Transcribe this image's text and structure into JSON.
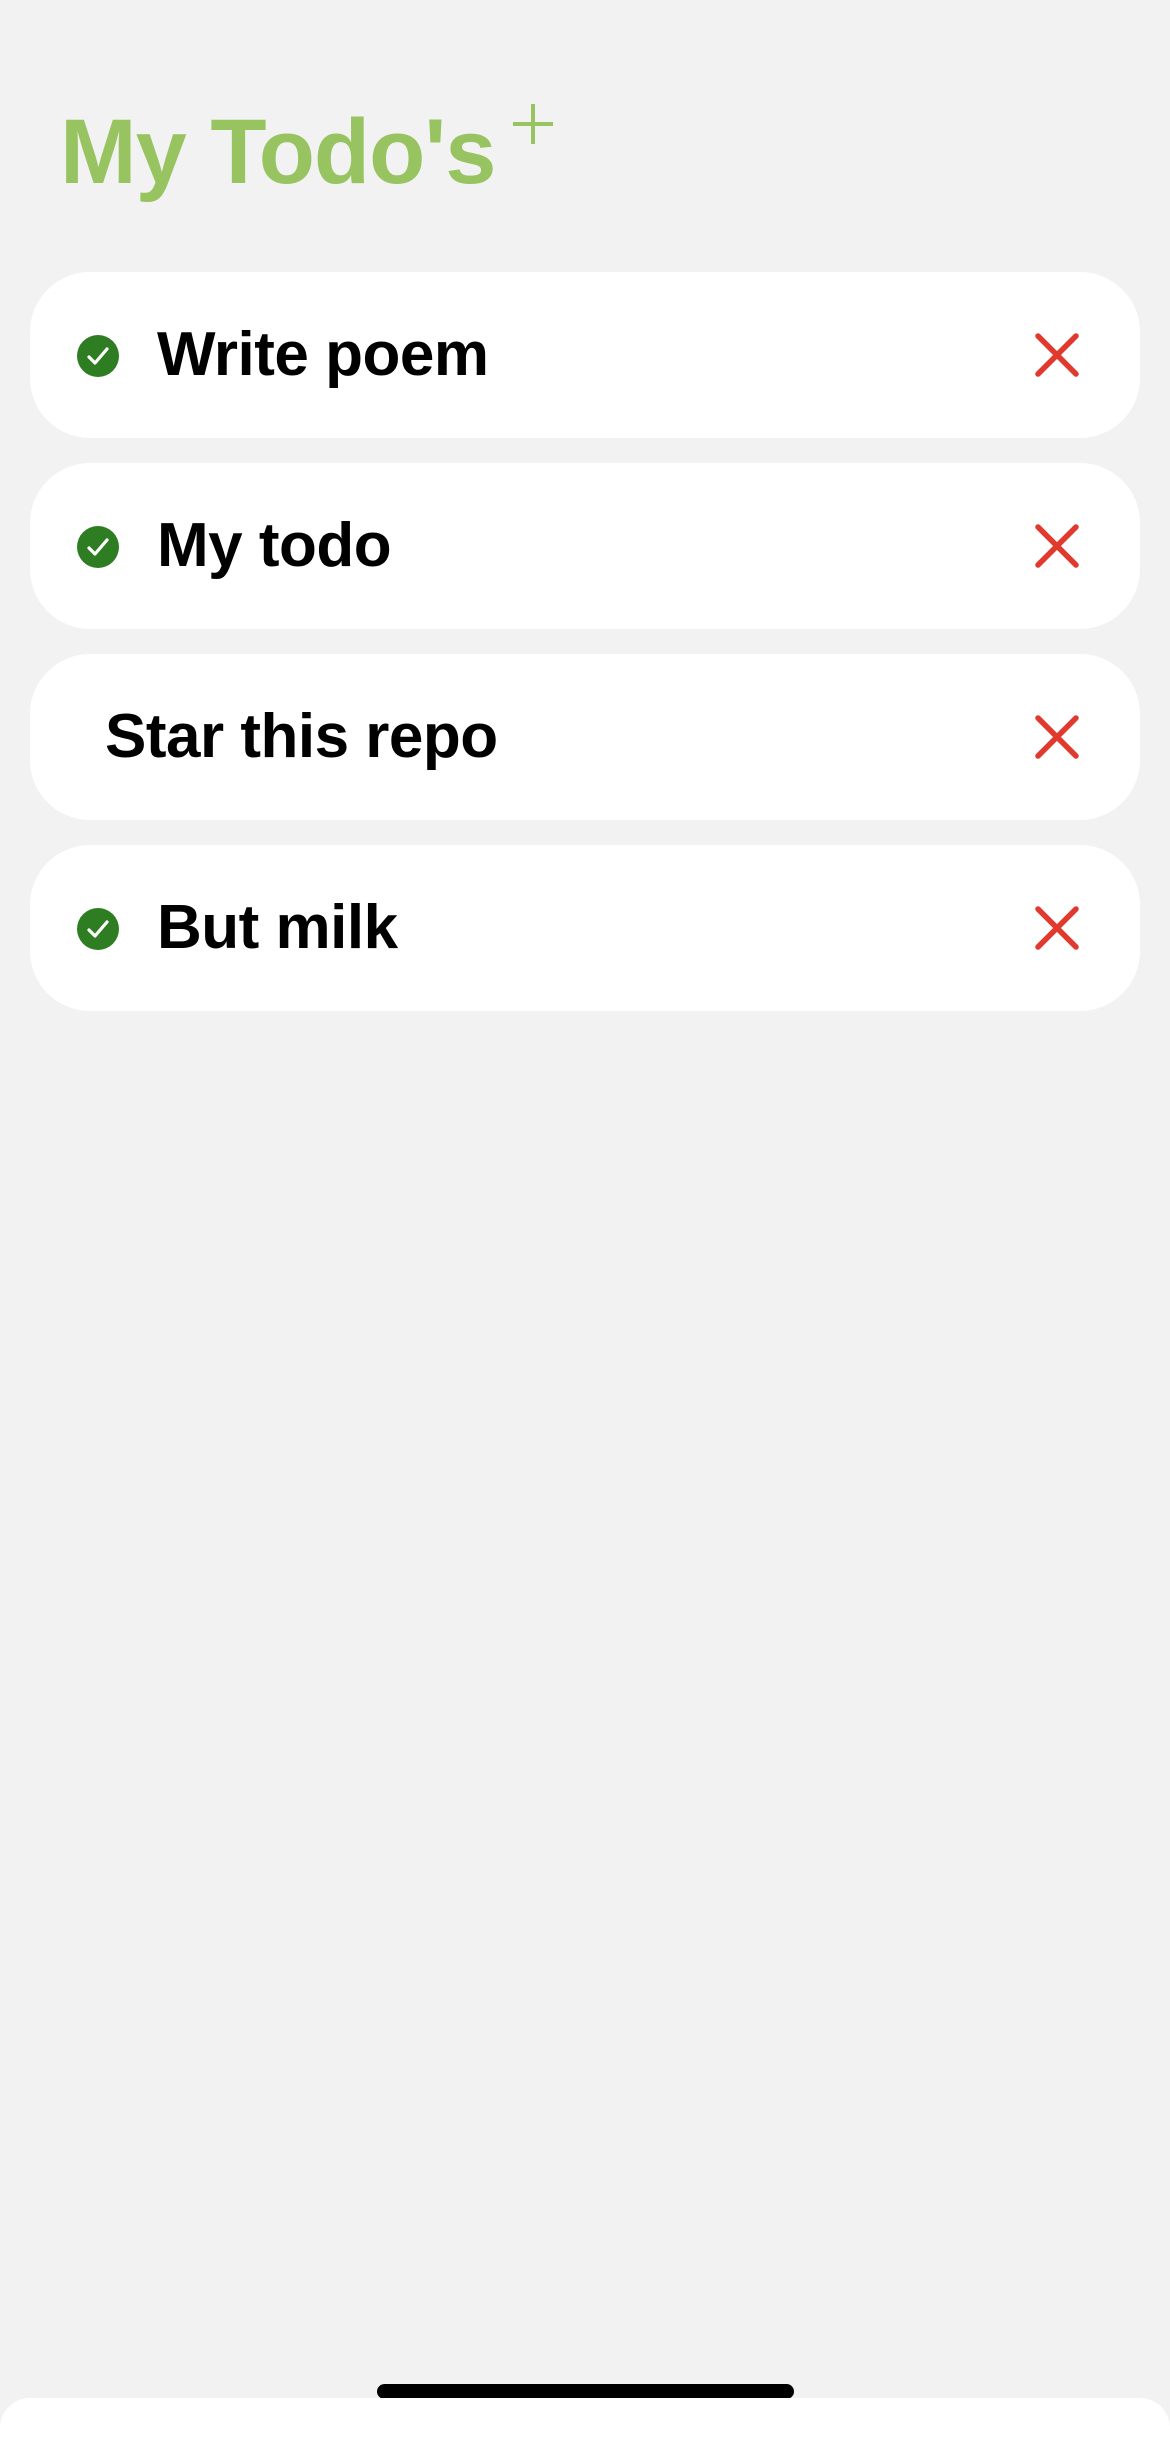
{
  "header": {
    "title": "My Todo's",
    "add_icon": "plus-icon"
  },
  "colors": {
    "title": "#97c461",
    "check": "#2f7d23",
    "delete": "#e03a2f",
    "background": "#f2f2f2",
    "card": "#ffffff"
  },
  "todos": [
    {
      "label": "Write poem",
      "done": true
    },
    {
      "label": "My todo",
      "done": true
    },
    {
      "label": "Star this repo",
      "done": false
    },
    {
      "label": "But milk",
      "done": true
    }
  ]
}
